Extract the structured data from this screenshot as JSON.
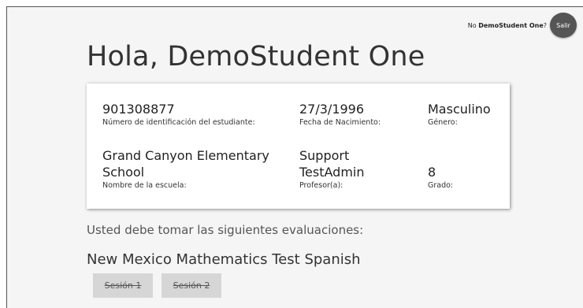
{
  "header": {
    "not_prefix": "No ",
    "student_name": "DemoStudent One",
    "not_suffix": "?",
    "logout_label": "Salir"
  },
  "greeting": "Hola, DemoStudent One",
  "student_info": {
    "id": {
      "value": "901308877",
      "label": "Número de identificación del estudiante:"
    },
    "dob": {
      "value": "27/3/1996",
      "label": "Fecha de Nacimiento:"
    },
    "gender": {
      "value": "Masculino",
      "label": "Género:"
    },
    "school": {
      "value": "Grand Canyon Elementary School",
      "label": "Nombre de la escuela:"
    },
    "teacher": {
      "value": "Support TestAdmin",
      "label": "Profesor(a):"
    },
    "grade": {
      "value": "8",
      "label": "Grado:"
    }
  },
  "instructions": "Usted debe tomar las siguientes evaluaciones:",
  "test": {
    "name": "New Mexico Mathematics Test Spanish",
    "sessions": [
      {
        "label": "Sesión 1",
        "state": "completed"
      },
      {
        "label": "Sesión 2",
        "state": "completed"
      }
    ]
  }
}
